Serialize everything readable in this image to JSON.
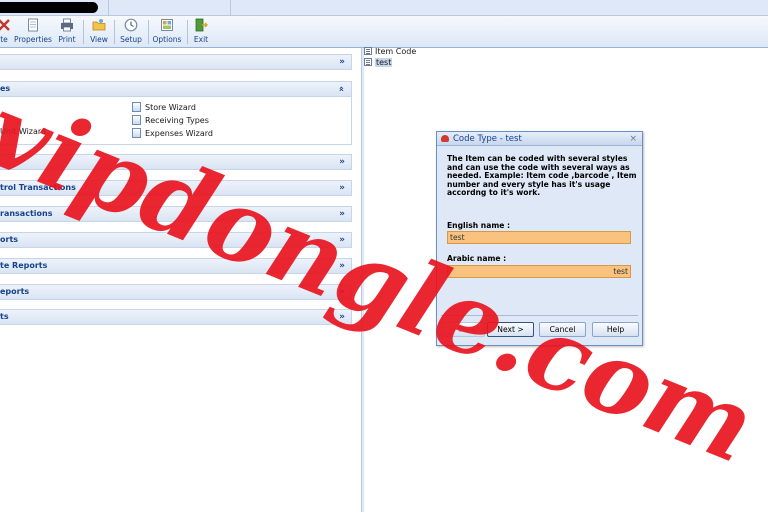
{
  "toolbar": {
    "items": [
      {
        "label": "te",
        "icon": "delete-icon"
      },
      {
        "label": "Properties",
        "icon": "document-icon"
      },
      {
        "label": "Print",
        "icon": "printer-icon"
      },
      {
        "label": "View",
        "icon": "folder-view-icon"
      },
      {
        "label": "Setup",
        "icon": "clock-icon"
      },
      {
        "label": "Options",
        "icon": "options-icon"
      },
      {
        "label": "Exit",
        "icon": "exit-door-icon"
      }
    ]
  },
  "left_panel": {
    "sections": [
      {
        "label": "",
        "state": "collapsed"
      },
      {
        "label": "es",
        "state": "expanded"
      },
      {
        "label": "",
        "state": "collapsed"
      },
      {
        "label": "trol Transactions",
        "state": "collapsed"
      },
      {
        "label": "ransactions",
        "state": "collapsed"
      },
      {
        "label": "orts",
        "state": "collapsed"
      },
      {
        "label": "te Reports",
        "state": "collapsed"
      },
      {
        "label": "eports",
        "state": "collapsed"
      },
      {
        "label": "ts",
        "state": "collapsed"
      }
    ],
    "wizards_left": [
      "Unit Wizard"
    ],
    "wizards_right": [
      "Store Wizard",
      "Receiving Types",
      "Expenses Wizard"
    ]
  },
  "tree": {
    "nodes": [
      {
        "label": "Item Code",
        "selected": false
      },
      {
        "label": "test",
        "selected": true
      }
    ]
  },
  "dialog": {
    "title": "Code Type - test",
    "description": "The Item can be coded with several styles and can use the code with several ways as needed. Example: Item code ,barcode , Item number and every style has it's usage accordng to it's work.",
    "english_label": "English name :",
    "english_value": "test",
    "arabic_label": "Arabic name :",
    "arabic_value": "test",
    "buttons": {
      "back": "< Back",
      "next": "Next >",
      "cancel": "Cancel",
      "help": "Help"
    },
    "close_glyph": "×"
  },
  "watermark": {
    "text": "vipdongle.com",
    "color": "#e8141e"
  },
  "colors": {
    "accent_text": "#15428b",
    "field_fill": "#f9c37f",
    "panel_header": "#d9e4f3"
  }
}
